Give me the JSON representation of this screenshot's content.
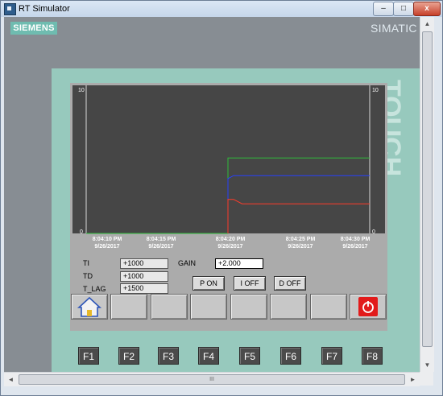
{
  "window": {
    "title": "RT Simulator",
    "minimize": "–",
    "maximize": "□",
    "close": "x"
  },
  "panel": {
    "brand": "SIEMENS",
    "model": "SIMATIC P"
  },
  "trend": {
    "y_axis_left_max": "10",
    "y_axis_left_min": "0",
    "y_axis_right_max": "10",
    "y_axis_right_min": "0",
    "time_labels": [
      {
        "time": "8:04:10 PM",
        "date": "9/26/2017"
      },
      {
        "time": "8:04:15 PM",
        "date": "9/26/2017"
      },
      {
        "time": "8:04:20 PM",
        "date": "9/26/2017"
      },
      {
        "time": "8:04:25 PM",
        "date": "9/26/2017"
      },
      {
        "time": "8:04:30 PM",
        "date": "9/26/2017"
      }
    ]
  },
  "chart_data": {
    "type": "line",
    "ylim": [
      0,
      10
    ],
    "x_range_seconds": [
      0,
      20
    ],
    "step_at_seconds": 10,
    "grid": false,
    "background": "#464646",
    "series": [
      {
        "color": "#2ebc3a",
        "x": [
          0,
          10,
          10,
          20
        ],
        "y": [
          0,
          0,
          5.1,
          5.1
        ]
      },
      {
        "color": "#2740ff",
        "x": [
          10,
          10,
          10.4,
          20
        ],
        "y": [
          0,
          3.7,
          3.9,
          3.9
        ]
      },
      {
        "color": "#ff3b2a",
        "x": [
          10,
          10,
          10.4,
          11,
          20
        ],
        "y": [
          0,
          2.3,
          2.3,
          2.0,
          2.0
        ]
      }
    ]
  },
  "controls": {
    "ti_label": "TI",
    "ti_value": "+1000",
    "td_label": "TD",
    "td_value": "+1000",
    "tlag_label": "T_LAG",
    "tlag_value": "+1500",
    "gain_label": "GAIN",
    "gain_value": "+2.000",
    "p_button": "P ON",
    "i_button": "I OFF",
    "d_button": "D OFF"
  },
  "softkeys": {
    "home_icon": "home-icon",
    "power_icon": "power-icon",
    "power_color": "#e21b1b"
  },
  "function_keys": [
    "F1",
    "F2",
    "F3",
    "F4",
    "F5",
    "F6",
    "F7",
    "F8"
  ],
  "scrollbars": {
    "up": "▲",
    "down": "▼",
    "left": "◄",
    "right": "►",
    "grip": "III"
  }
}
